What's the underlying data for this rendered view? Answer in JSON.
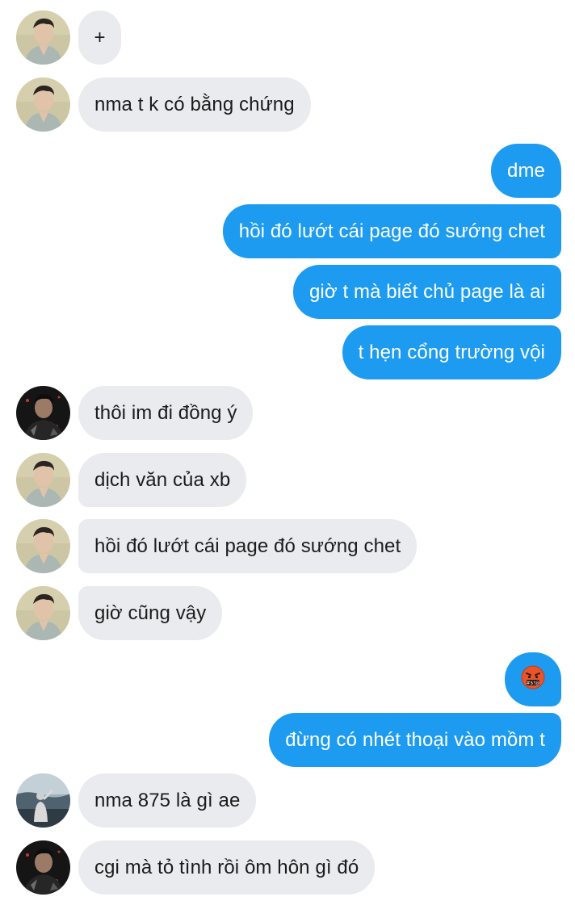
{
  "conversation": {
    "messages": [
      {
        "id": "m1",
        "side": "incoming",
        "sender": "friend-a",
        "text": "+"
      },
      {
        "id": "m2",
        "side": "incoming",
        "sender": "friend-a",
        "text": "nma t k có bằng chứng"
      },
      {
        "id": "m3",
        "side": "outgoing",
        "text": "dme"
      },
      {
        "id": "m4",
        "side": "outgoing",
        "text": "hồi đó lướt cái page đó sướng chet"
      },
      {
        "id": "m5",
        "side": "outgoing",
        "text": "giờ t mà biết chủ page là ai"
      },
      {
        "id": "m6",
        "side": "outgoing",
        "text": "t hẹn cổng trường vội"
      },
      {
        "id": "m7",
        "side": "incoming",
        "sender": "friend-b",
        "text": "thôi im đi đồng ý"
      },
      {
        "id": "m8",
        "side": "incoming",
        "sender": "friend-a",
        "text": "dịch văn của xb"
      },
      {
        "id": "m9",
        "side": "incoming",
        "sender": "friend-a",
        "text": "hồi đó lướt cái page đó sướng chet"
      },
      {
        "id": "m10",
        "side": "incoming",
        "sender": "friend-a",
        "text": "giờ cũng vậy"
      },
      {
        "id": "m11",
        "side": "outgoing",
        "text": "🤬",
        "emoji": "face-with-symbols-on-mouth"
      },
      {
        "id": "m12",
        "side": "outgoing",
        "text": "đừng có nhét thoại vào mồm t"
      },
      {
        "id": "m13",
        "side": "incoming",
        "sender": "friend-c",
        "text": "nma 875 là gì ae"
      },
      {
        "id": "m14",
        "side": "incoming",
        "sender": "friend-b",
        "text": "cgi mà tỏ tình rồi ôm hôn gì đó"
      }
    ]
  },
  "colors": {
    "incoming_bubble": "#e9ebef",
    "outgoing_bubble": "#1d9bf0",
    "incoming_text": "#1b1b1b",
    "outgoing_text": "#ffffff",
    "background": "#ffffff"
  }
}
